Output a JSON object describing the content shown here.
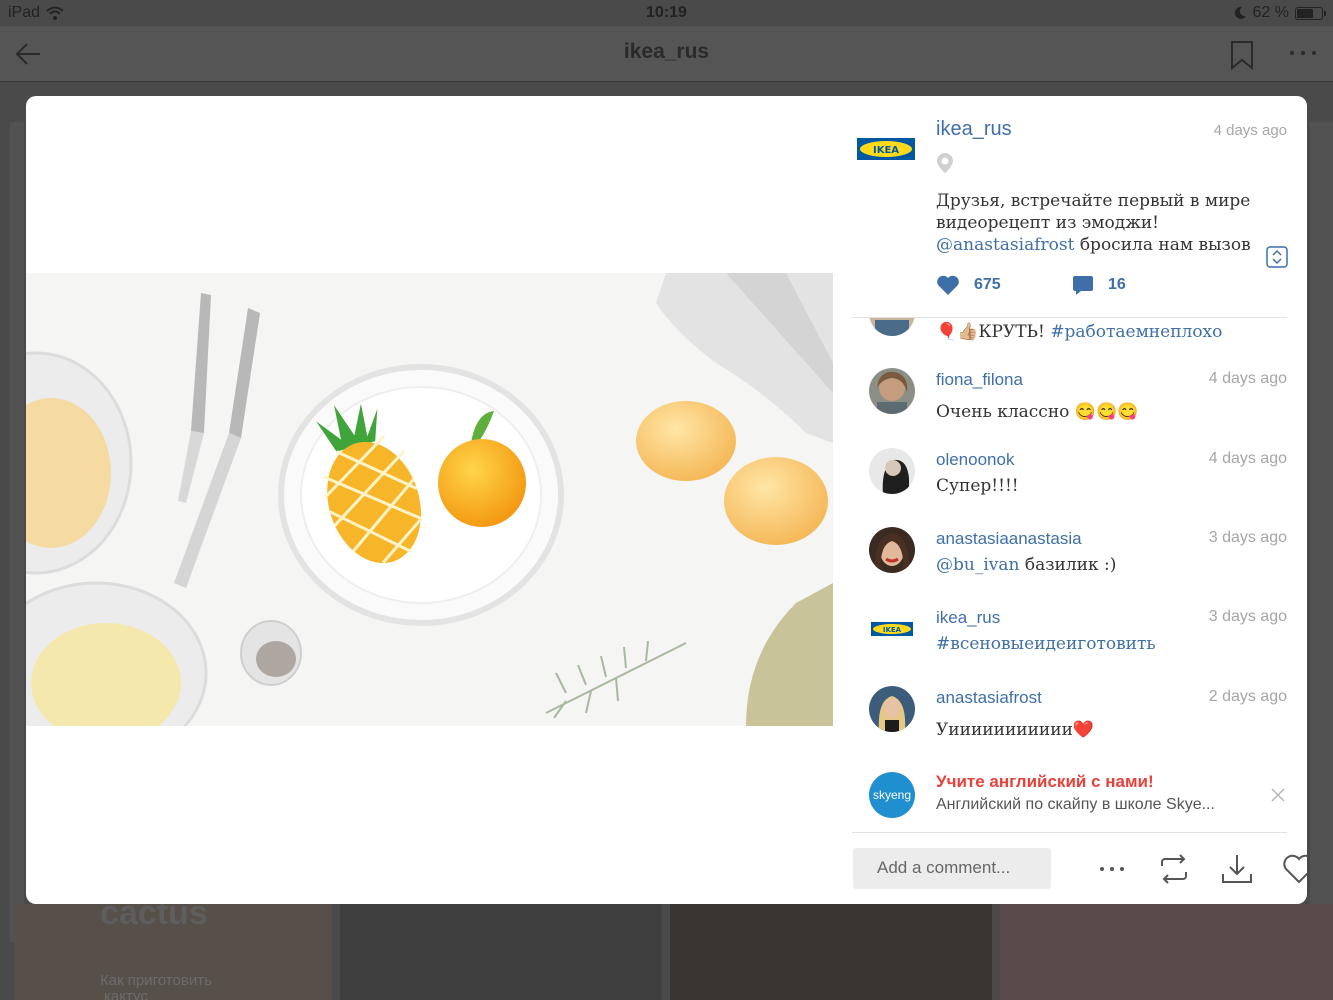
{
  "status": {
    "device": "iPad",
    "time": "10:19",
    "battery": "62 %"
  },
  "background": {
    "title": "ikea_rus",
    "tile_text_1": "cactus",
    "tile_text_2": "Как приготовить",
    "tile_text_3": "кактус"
  },
  "post": {
    "author": "ikea_rus",
    "time": "4 days ago",
    "caption_line1": "Друзья, встречайте первый в мире",
    "caption_line2": "видеорецепт из эмоджи!",
    "caption_mention": "@anastasiafrost",
    "caption_line3_rest": " бросила нам вызов ",
    "likes": "675",
    "comments_count": "16"
  },
  "comments": [
    {
      "user": "",
      "time": "",
      "text_prefix": "🎈👍🏼КРУТЬ! ",
      "tag": "#работаемнеплохо",
      "avatar": "partial"
    },
    {
      "user": "fiona_filona",
      "time": "4 days ago",
      "text": "Очень классно 😋😋😋",
      "avatar": "fiona"
    },
    {
      "user": "olenoonok",
      "time": "4 days ago",
      "text": "Супер!!!!",
      "avatar": "olen"
    },
    {
      "user": "anastasiaanastasia",
      "time": "3 days ago",
      "mention": "@bu_ivan",
      "text_rest": "  базилик :)",
      "avatar": "anastasia"
    },
    {
      "user": "ikea_rus",
      "time": "3 days ago",
      "tag": "#всеновыеидеиготовить",
      "avatar": "ikea"
    },
    {
      "user": "anastasiafrost",
      "time": "2 days ago",
      "text": "Уиииииииииии❤️",
      "avatar": "frost"
    }
  ],
  "ad": {
    "brand": "skyeng",
    "title": "Учите английский с нами!",
    "text": "Английский по скайпу в школе Skye..."
  },
  "footer": {
    "add_comment_placeholder": "Add a comment..."
  },
  "colors": {
    "link": "#3f6fa8",
    "ad_title": "#e8413a",
    "muted": "#a6a6a6",
    "ikea_blue": "#0058a3",
    "ikea_yellow": "#ffda1a"
  },
  "icons": [
    "back-arrow-icon",
    "bookmark-icon",
    "more-icon",
    "location-icon",
    "expand-icon",
    "heart-icon",
    "comment-icon",
    "close-icon",
    "repost-icon",
    "download-icon",
    "like-outline-icon"
  ]
}
